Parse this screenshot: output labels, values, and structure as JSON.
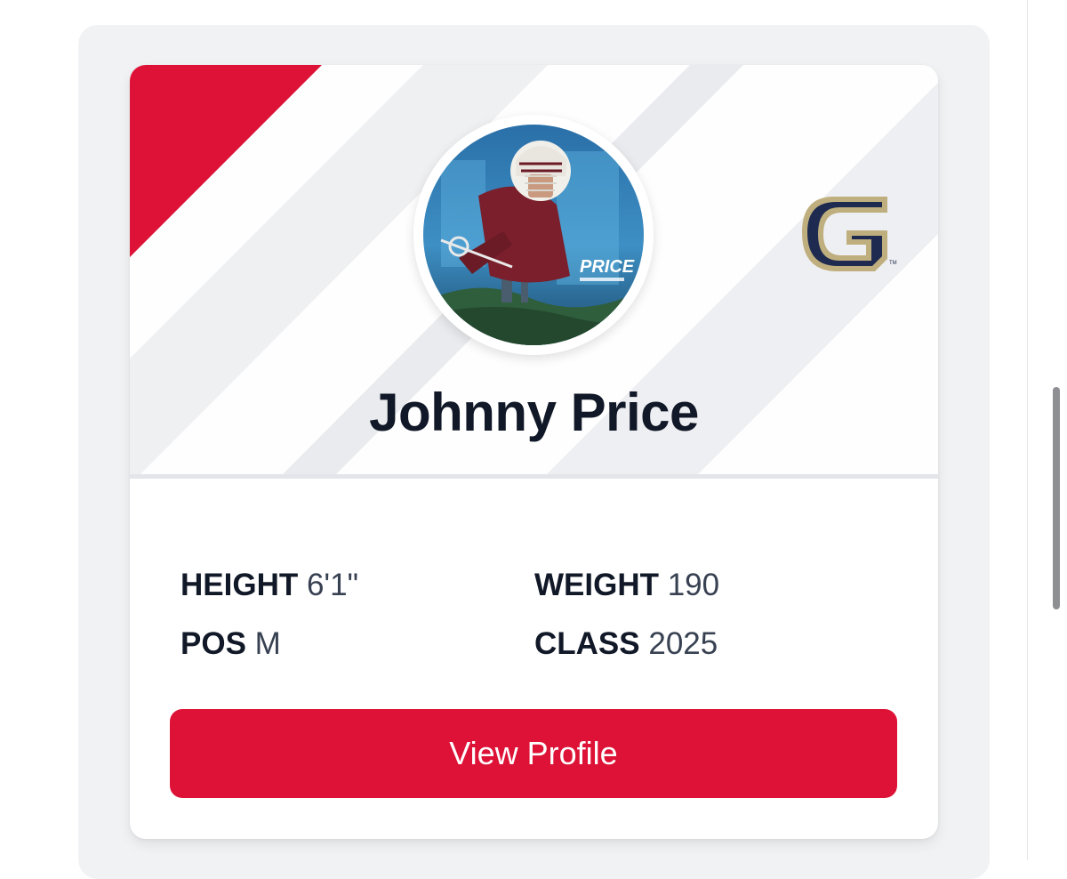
{
  "player": {
    "name": "Johnny Price",
    "photo_icon": "player-photo"
  },
  "team": {
    "logo_icon": "team-logo-g",
    "logo_letter": "G",
    "brand_color": "#dd1236",
    "logo_navy": "#1e2a4f",
    "logo_gold": "#bfae7e"
  },
  "stats": {
    "height": {
      "label": "HEIGHT",
      "value": "6'1\""
    },
    "weight": {
      "label": "WEIGHT",
      "value": "190"
    },
    "position": {
      "label": "POS",
      "value": "M"
    },
    "class": {
      "label": "CLASS",
      "value": "2025"
    }
  },
  "actions": {
    "view_profile_label": "View Profile"
  }
}
